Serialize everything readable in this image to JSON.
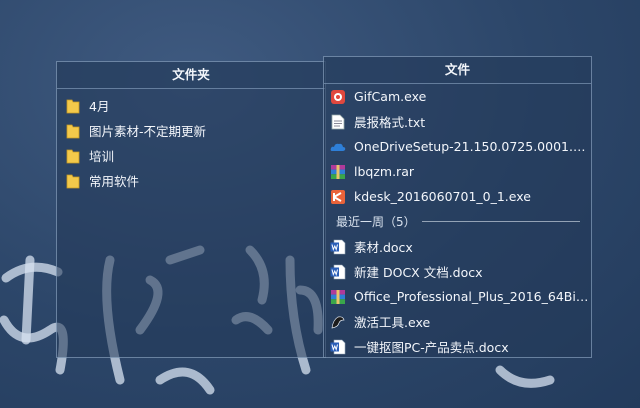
{
  "folders_panel": {
    "title": "文件夹",
    "items": [
      {
        "label": "4月",
        "icon": "folder-icon"
      },
      {
        "label": "图片素材-不定期更新",
        "icon": "folder-icon"
      },
      {
        "label": "培训",
        "icon": "folder-icon"
      },
      {
        "label": "常用软件",
        "icon": "folder-icon"
      }
    ]
  },
  "files_panel": {
    "title": "文件",
    "items": [
      {
        "label": "GifCam.exe",
        "icon": "gifcam-icon"
      },
      {
        "label": "晨报格式.txt",
        "icon": "text-file-icon"
      },
      {
        "label": "OneDriveSetup-21.150.0725.0001.e...",
        "icon": "onedrive-icon"
      },
      {
        "label": "lbqzm.rar",
        "icon": "archive-icon"
      },
      {
        "label": "kdesk_2016060701_0_1.exe",
        "icon": "kdesk-icon"
      }
    ],
    "section_label": "最近一周（5）",
    "recent_items": [
      {
        "label": "素材.docx",
        "icon": "word-doc-icon"
      },
      {
        "label": "新建 DOCX 文档.docx",
        "icon": "word-doc-icon"
      },
      {
        "label": "Office_Professional_Plus_2016_64Bit...",
        "icon": "archive-icon"
      },
      {
        "label": "激活工具.exe",
        "icon": "activator-icon"
      },
      {
        "label": "一键抠图PC-产品卖点.docx",
        "icon": "word-doc-icon"
      }
    ]
  },
  "colors": {
    "folder": "#f3c94b",
    "accent_red": "#e0483e",
    "onedrive": "#2e7fd8",
    "word": "#2b5fb8"
  }
}
